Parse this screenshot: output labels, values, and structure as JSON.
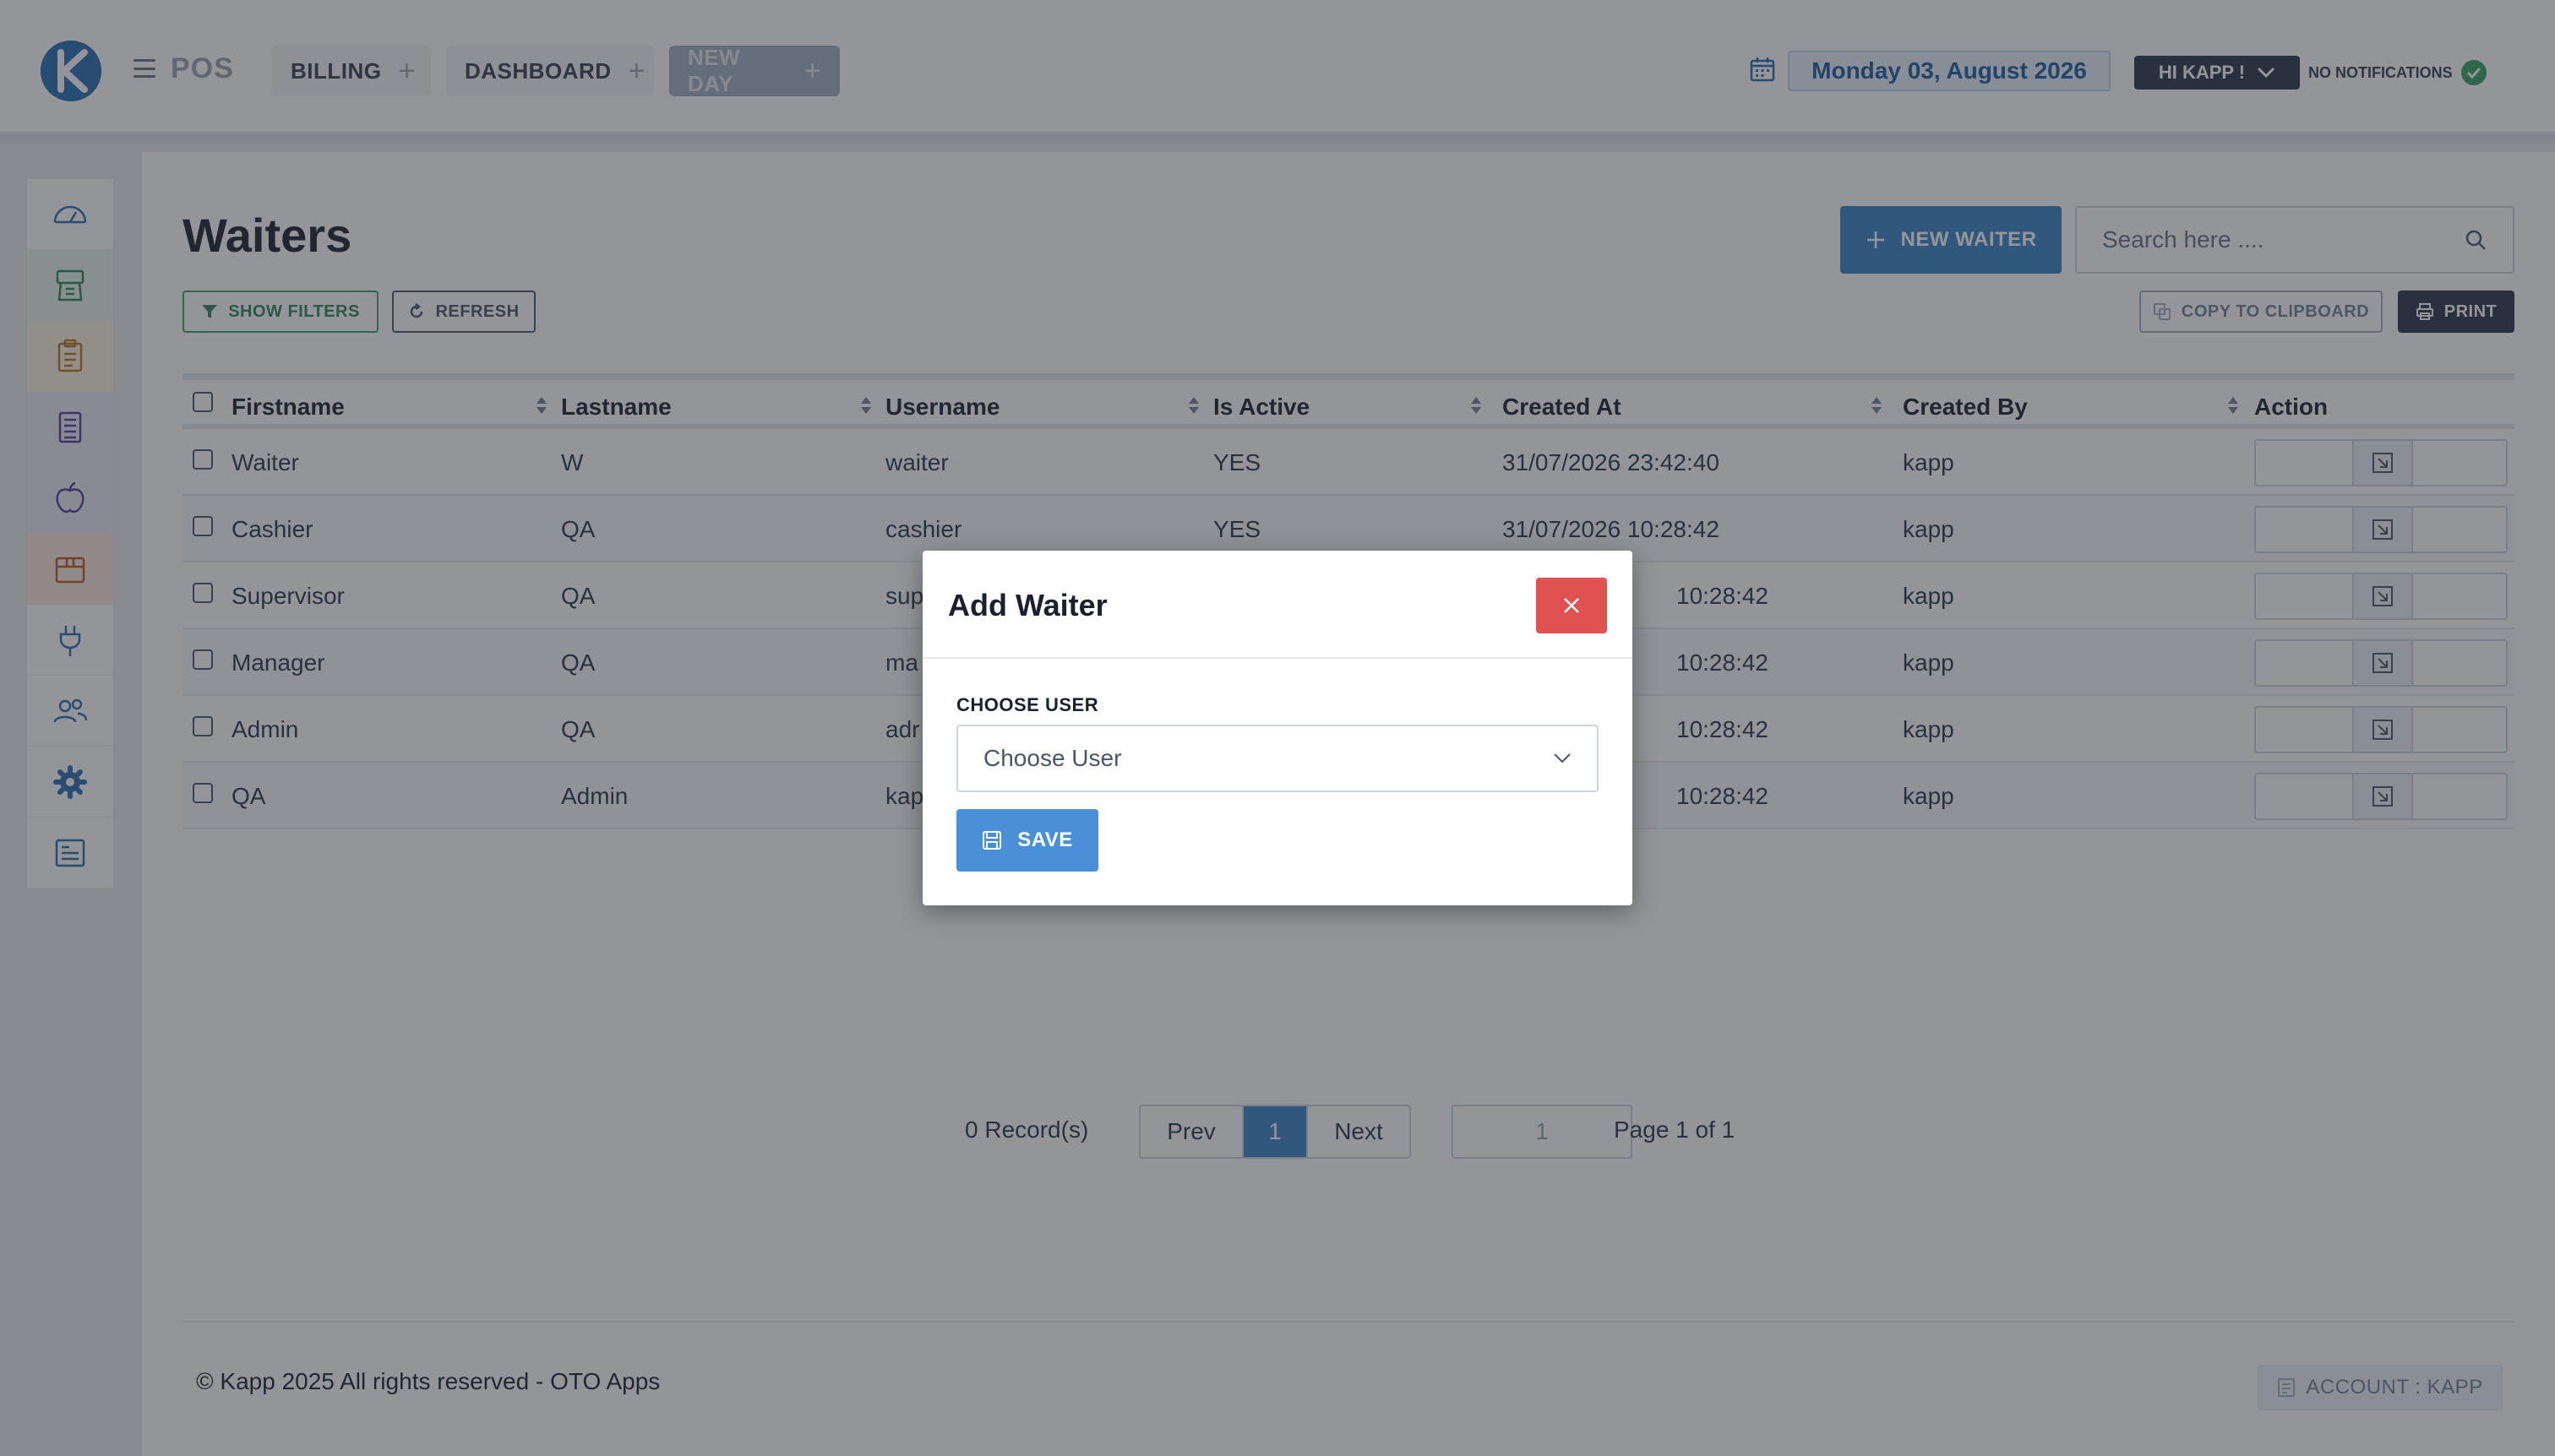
{
  "header": {
    "app_name": "POS",
    "tabs": [
      {
        "label": "BILLING"
      },
      {
        "label": "DASHBOARD"
      },
      {
        "label": "NEW DAY"
      }
    ],
    "date": "Monday 03, August 2026",
    "user_greeting": "HI KAPP !",
    "notifications": "NO NOTIFICATIONS"
  },
  "sidebar": {
    "items": [
      {
        "icon": "speedometer-icon",
        "color": "#ffffff"
      },
      {
        "icon": "cash-register-icon",
        "color": "#e6f4ea"
      },
      {
        "icon": "clipboard-icon",
        "color": "#fdf3df"
      },
      {
        "icon": "receipt-icon",
        "color": "#ece9f6"
      },
      {
        "icon": "apple-icon",
        "color": "#ece9f6"
      },
      {
        "icon": "box-icon",
        "color": "#fbe9df"
      },
      {
        "icon": "plug-icon",
        "color": "#ffffff"
      },
      {
        "icon": "users-icon",
        "color": "#ffffff"
      },
      {
        "icon": "gear-icon",
        "color": "#ffffff"
      },
      {
        "icon": "document-icon",
        "color": "#ffffff"
      }
    ]
  },
  "page": {
    "title": "Waiters",
    "new_button": "NEW WAITER",
    "search_placeholder": "Search here ....",
    "show_filters": "SHOW FILTERS",
    "refresh": "REFRESH",
    "copy_to_clipboard": "COPY TO CLIPBOARD",
    "print": "PRINT"
  },
  "table": {
    "columns": [
      "Firstname",
      "Lastname",
      "Username",
      "Is Active",
      "Created At",
      "Created By",
      "Action"
    ],
    "rows": [
      {
        "firstname": "Waiter",
        "lastname": "W",
        "username": "waiter",
        "is_active": "YES",
        "created_at": "31/07/2026 23:42:40",
        "created_by": "kapp"
      },
      {
        "firstname": "Cashier",
        "lastname": "QA",
        "username": "cashier",
        "is_active": "YES",
        "created_at": "31/07/2026 10:28:42",
        "created_by": "kapp"
      },
      {
        "firstname": "Supervisor",
        "lastname": "QA",
        "username": "sup",
        "is_active": "",
        "created_at": "10:28:42",
        "created_by": "kapp"
      },
      {
        "firstname": "Manager",
        "lastname": "QA",
        "username": "ma",
        "is_active": "",
        "created_at": "10:28:42",
        "created_by": "kapp"
      },
      {
        "firstname": "Admin",
        "lastname": "QA",
        "username": "adr",
        "is_active": "",
        "created_at": "10:28:42",
        "created_by": "kapp"
      },
      {
        "firstname": "QA",
        "lastname": "Admin",
        "username": "kap",
        "is_active": "",
        "created_at": "10:28:42",
        "created_by": "kapp"
      }
    ]
  },
  "pagination": {
    "records": "0 Record(s)",
    "prev": "Prev",
    "current": "1",
    "next": "Next",
    "page_input": "1",
    "page_of": "Page 1 of 1"
  },
  "footer": {
    "copyright": "© Kapp 2025 All rights reserved - OTO Apps",
    "account": "ACCOUNT : KAPP"
  },
  "modal": {
    "title": "Add Waiter",
    "field_label": "CHOOSE USER",
    "select_placeholder": "Choose User",
    "save": "SAVE"
  },
  "colors": {
    "primary": "#3b82c4",
    "danger": "#e05252",
    "success": "#38a169",
    "dark": "#2d3748"
  }
}
